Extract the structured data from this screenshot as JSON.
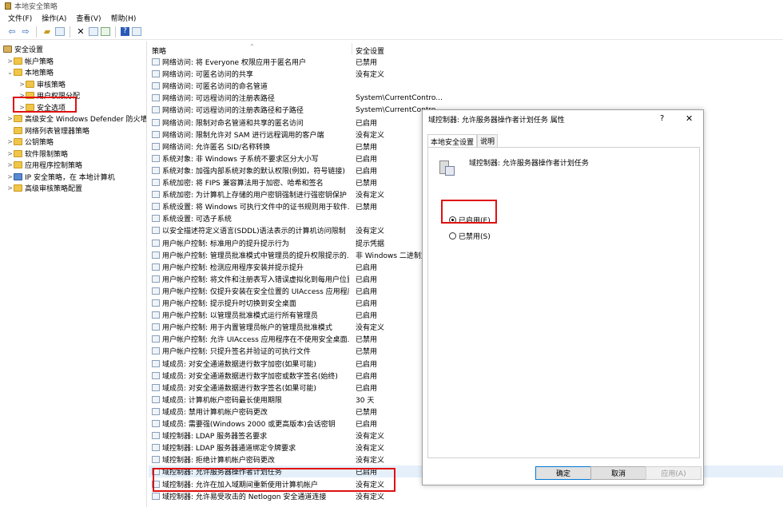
{
  "window": {
    "title": "本地安全策略"
  },
  "menu": [
    "文件(F)",
    "操作(A)",
    "查看(V)",
    "帮助(H)"
  ],
  "toolbar": [
    "back-icon",
    "forward-icon",
    "up-folder-icon",
    "show-tree-icon",
    "delete-icon",
    "properties-icon",
    "export-icon",
    "help-icon",
    "view-icon"
  ],
  "tree": [
    {
      "label": "安全设置",
      "indent": 0,
      "chev": "",
      "icon": "book"
    },
    {
      "label": "帐户策略",
      "indent": 1,
      "chev": ">",
      "icon": "folder"
    },
    {
      "label": "本地策略",
      "indent": 1,
      "chev": "v",
      "icon": "folder"
    },
    {
      "label": "审核策略",
      "indent": 2,
      "chev": ">",
      "icon": "folder"
    },
    {
      "label": "用户权限分配",
      "indent": 2,
      "chev": ">",
      "icon": "folder"
    },
    {
      "label": "安全选项",
      "indent": 2,
      "chev": ">",
      "icon": "folder"
    },
    {
      "label": "高级安全 Windows Defender 防火墙",
      "indent": 1,
      "chev": ">",
      "icon": "folder"
    },
    {
      "label": "网络列表管理器策略",
      "indent": 1,
      "chev": "",
      "icon": "folder"
    },
    {
      "label": "公钥策略",
      "indent": 1,
      "chev": ">",
      "icon": "folder"
    },
    {
      "label": "软件限制策略",
      "indent": 1,
      "chev": ">",
      "icon": "folder"
    },
    {
      "label": "应用程序控制策略",
      "indent": 1,
      "chev": ">",
      "icon": "folder"
    },
    {
      "label": "IP 安全策略，在 本地计算机",
      "indent": 1,
      "chev": ">",
      "icon": "net"
    },
    {
      "label": "高级审核策略配置",
      "indent": 1,
      "chev": ">",
      "icon": "folder"
    }
  ],
  "list": {
    "col_policy": "策略",
    "col_setting": "安全设置",
    "rows": [
      [
        "网络访问: 将 Everyone 权限应用于匿名用户",
        "已禁用"
      ],
      [
        "网络访问: 可匿名访问的共享",
        "没有定义"
      ],
      [
        "网络访问: 可匿名访问的命名管道",
        ""
      ],
      [
        "网络访问: 可远程访问的注册表路径",
        "System\\CurrentContro..."
      ],
      [
        "网络访问: 可远程访问的注册表路径和子路径",
        "System\\CurrentContro..."
      ],
      [
        "网络访问: 限制对命名管道和共享的匿名访问",
        "已启用"
      ],
      [
        "网络访问: 限制允许对 SAM 进行远程调用的客户端",
        "没有定义"
      ],
      [
        "网络访问: 允许匿名 SID/名称转换",
        "已禁用"
      ],
      [
        "系统对象: 非 Windows 子系统不要求区分大小写",
        "已启用"
      ],
      [
        "系统对象: 加强内部系统对象的默认权限(例如，符号链接)",
        "已启用"
      ],
      [
        "系统加密: 将 FIPS 兼容算法用于加密、哈希和签名",
        "已禁用"
      ],
      [
        "系统加密: 为计算机上存储的用户密钥强制进行强密钥保护",
        "没有定义"
      ],
      [
        "系统设置: 将 Windows 可执行文件中的证书规则用于软件...",
        "已禁用"
      ],
      [
        "系统设置: 可选子系统",
        ""
      ],
      [
        "以安全描述符定义语言(SDDL)语法表示的计算机访问限制",
        "没有定义"
      ],
      [
        "用户帐户控制: 标准用户的提升提示行为",
        "提示凭据"
      ],
      [
        "用户帐户控制: 管理员批准模式中管理员的提升权限提示的...",
        "非 Windows 二进制文"
      ],
      [
        "用户帐户控制: 检测应用程序安装并提示提升",
        "已启用"
      ],
      [
        "用户帐户控制: 将文件和注册表写入错误虚拟化到每用户位置",
        "已启用"
      ],
      [
        "用户帐户控制: 仅提升安装在安全位置的 UIAccess 应用程序",
        "已启用"
      ],
      [
        "用户帐户控制: 提示提升时切换到安全桌面",
        "已启用"
      ],
      [
        "用户帐户控制: 以管理员批准模式运行所有管理员",
        "已启用"
      ],
      [
        "用户帐户控制: 用于内置管理员帐户的管理员批准模式",
        "没有定义"
      ],
      [
        "用户帐户控制: 允许 UIAccess 应用程序在不使用安全桌面...",
        "已禁用"
      ],
      [
        "用户帐户控制: 只提升签名并验证的可执行文件",
        "已禁用"
      ],
      [
        "域成员: 对安全通道数据进行数字加密(如果可能)",
        "已启用"
      ],
      [
        "域成员: 对安全通道数据进行数字加密或数字签名(始终)",
        "已启用"
      ],
      [
        "域成员: 对安全通道数据进行数字签名(如果可能)",
        "已启用"
      ],
      [
        "域成员: 计算机帐户密码最长使用期限",
        "30 天"
      ],
      [
        "域成员: 禁用计算机帐户密码更改",
        "已禁用"
      ],
      [
        "域成员: 需要强(Windows 2000 或更高版本)会话密钥",
        "已启用"
      ],
      [
        "域控制器: LDAP 服务器签名要求",
        "没有定义"
      ],
      [
        "域控制器: LDAP 服务器通道绑定令牌要求",
        "没有定义"
      ],
      [
        "域控制器: 拒绝计算机帐户密码更改",
        "没有定义"
      ],
      [
        "域控制器: 允许服务器操作者计划任务",
        "已启用"
      ],
      [
        "域控制器: 允许在加入域期间重新使用计算机帐户",
        "没有定义"
      ],
      [
        "域控制器: 允许易受攻击的 Netlogon 安全通道连接",
        "没有定义"
      ]
    ]
  },
  "dialog": {
    "title": "域控制器: 允许服务器操作者计划任务 属性",
    "help": "?",
    "close": "✕",
    "tab_local": "本地安全设置",
    "tab_explain": "说明",
    "policy_name": "域控制器: 允许服务器操作者计划任务",
    "enabled_label": "已启用(E)",
    "disabled_label": "已禁用(S)",
    "selected": "enabled",
    "ok": "确定",
    "cancel": "取消",
    "apply": "应用(A)"
  }
}
